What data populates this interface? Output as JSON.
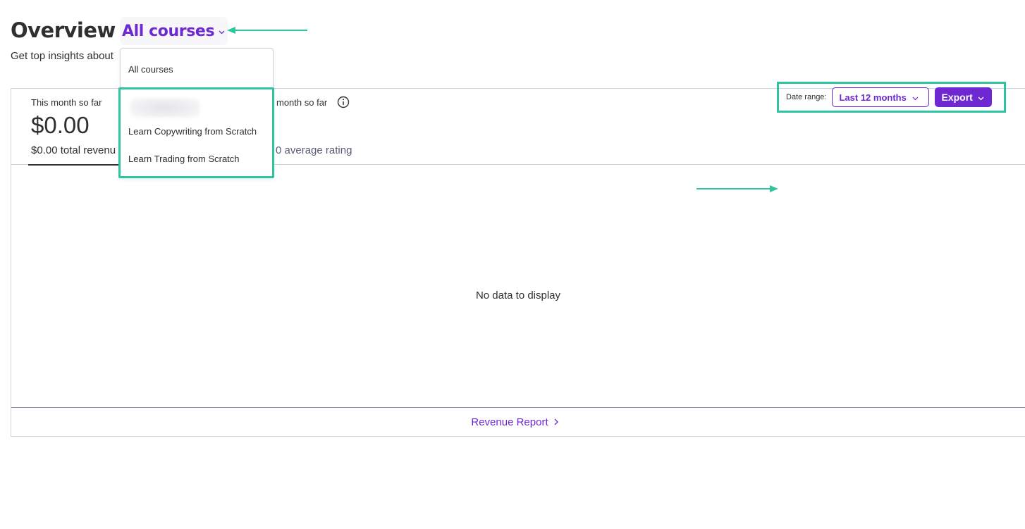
{
  "header": {
    "title": "Overview",
    "course_selector": "All courses",
    "subtitle": "Get top insights about"
  },
  "dropdown": {
    "items": [
      "All courses",
      "Learn Copywriting from Scratch",
      "Learn Trading from Scratch"
    ]
  },
  "stats": {
    "revenue": {
      "label": "This month so far",
      "value": "$0.00",
      "sub": "$0.00 total revenu"
    },
    "rating": {
      "label": "month so far",
      "sub": "0 average rating"
    }
  },
  "controls": {
    "date_range_label": "Date range:",
    "date_range_value": "Last 12 months",
    "export_label": "Export"
  },
  "chart": {
    "empty_message": "No data to display"
  },
  "footer": {
    "link_label": "Revenue Report"
  },
  "colors": {
    "accent": "#6d28d2",
    "highlight": "#2ec4a0",
    "text": "#2d2f31",
    "border": "#d1d2e0"
  },
  "icons": {
    "selector_chevron": "chevron-down-icon",
    "info": "info-icon",
    "footer_chevron": "chevron-right-icon"
  }
}
